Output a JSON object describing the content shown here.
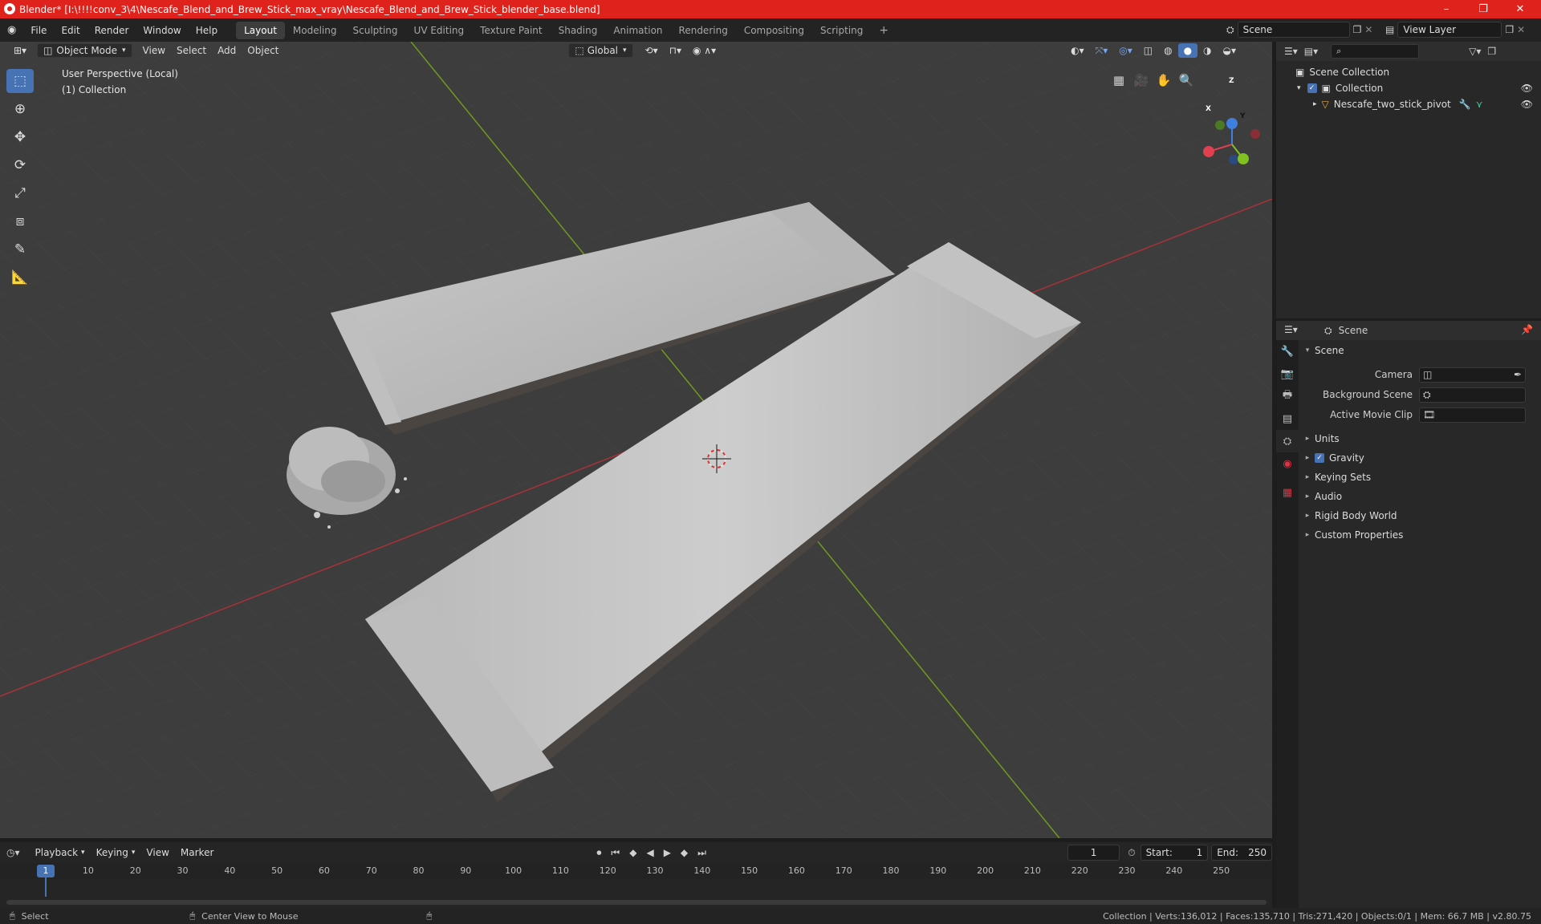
{
  "window": {
    "title": "Blender* [I:\\!!!!conv_3\\4\\Nescafe_Blend_and_Brew_Stick_max_vray\\Nescafe_Blend_and_Brew_Stick_blender_base.blend]",
    "minimize": "–",
    "maximize": "❐",
    "close": "✕"
  },
  "menu": {
    "file": "File",
    "edit": "Edit",
    "render": "Render",
    "window": "Window",
    "help": "Help"
  },
  "workspaces": [
    "Layout",
    "Modeling",
    "Sculpting",
    "UV Editing",
    "Texture Paint",
    "Shading",
    "Animation",
    "Rendering",
    "Compositing",
    "Scripting"
  ],
  "workspace_add": "+",
  "scene_field": "Scene",
  "view_layer_field": "View Layer",
  "viewport_header": {
    "mode": "Object Mode",
    "view": "View",
    "select": "Select",
    "add": "Add",
    "object": "Object",
    "orientation": "Global"
  },
  "viewport": {
    "perspective_label": "User Perspective (Local)",
    "collection_label": "(1) Collection",
    "gizmo": {
      "x": "X",
      "y": "Y",
      "z": "Z"
    }
  },
  "outliner": {
    "scene_collection": "Scene Collection",
    "collection": "Collection",
    "object": "Nescafe_two_stick_pivot"
  },
  "properties": {
    "header": "Scene",
    "panel_title": "Scene",
    "camera_label": "Camera",
    "background_scene_label": "Background Scene",
    "active_movie_clip_label": "Active Movie Clip",
    "sections": {
      "units": "Units",
      "gravity": "Gravity",
      "keying_sets": "Keying Sets",
      "audio": "Audio",
      "rigid_body_world": "Rigid Body World",
      "custom_properties": "Custom Properties"
    }
  },
  "timeline": {
    "playback": "Playback",
    "keying": "Keying",
    "view": "View",
    "marker": "Marker",
    "current_frame": "1",
    "start_label": "Start:",
    "start_value": "1",
    "end_label": "End:",
    "end_value": "250",
    "ruler": [
      "1",
      "10",
      "20",
      "30",
      "40",
      "50",
      "60",
      "70",
      "80",
      "90",
      "100",
      "110",
      "120",
      "130",
      "140",
      "150",
      "160",
      "170",
      "180",
      "190",
      "200",
      "210",
      "220",
      "230",
      "240",
      "250"
    ]
  },
  "statusbar": {
    "select": "Select",
    "center_view": "Center View to Mouse",
    "stats": "Collection | Verts:136,012 | Faces:135,710 | Tris:271,420 | Objects:0/1 | Mem: 66.7 MB | v2.80.75"
  },
  "colors": {
    "titlebar": "#e0221c",
    "accent": "#4772b3",
    "viewport_bg": "#3d3d3d",
    "axis_x": "#c0333d",
    "axis_y": "#6a9a1f"
  }
}
